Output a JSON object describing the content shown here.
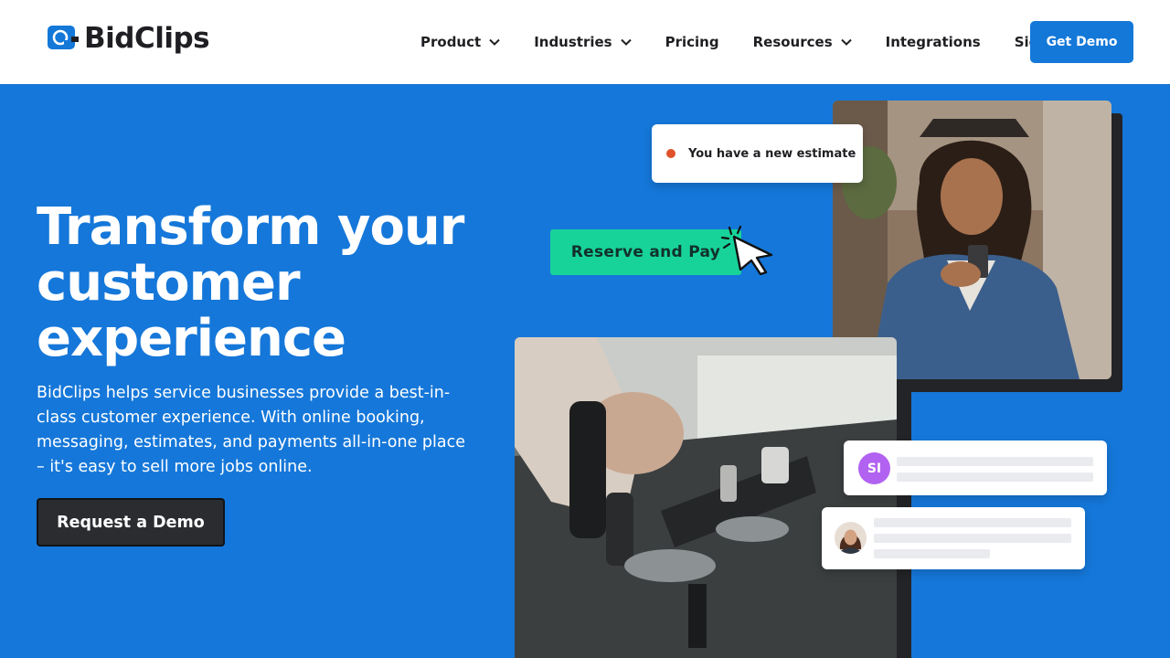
{
  "brand": {
    "name": "BidClips",
    "logo_icon": "chat-bubble-icon",
    "primary_color": "#1478d8",
    "accent_color": "#17d39a"
  },
  "nav": {
    "items": [
      {
        "label": "Product",
        "has_dropdown": true
      },
      {
        "label": "Industries",
        "has_dropdown": true
      },
      {
        "label": "Pricing",
        "has_dropdown": false
      },
      {
        "label": "Resources",
        "has_dropdown": true
      },
      {
        "label": "Integrations",
        "has_dropdown": false
      },
      {
        "label": "Sign In",
        "has_dropdown": false
      }
    ],
    "cta_label": "Get Demo"
  },
  "hero": {
    "title_lines": [
      "Transform your",
      "customer",
      "experience"
    ],
    "description": "BidClips helps service businesses provide a best-in-class customer experience. With online booking, messaging, estimates, and payments all-in-one place – it's easy to sell more jobs online.",
    "cta_label": "Request a Demo"
  },
  "illustration": {
    "notification_text": "You have a new estimate",
    "reserve_button_label": "Reserve and Pay",
    "chat_avatar_initials": "SI"
  }
}
